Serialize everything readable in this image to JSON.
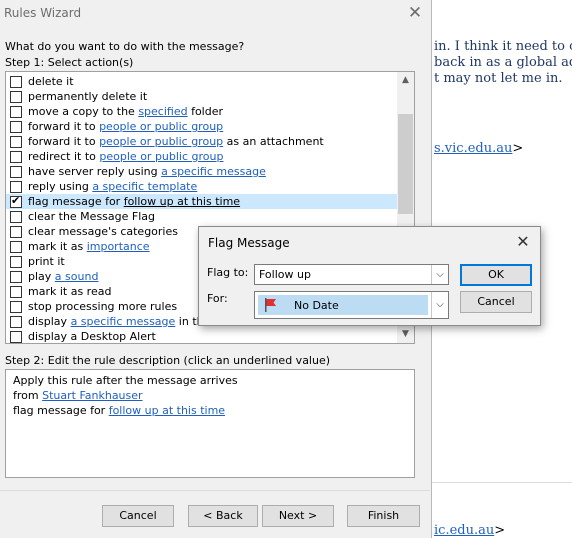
{
  "background_email": {
    "line1": "in. I think it need to ca",
    "line2": "back in as a global adm",
    "line3": "t may not let me in.",
    "email1_domain": "s.vic.edu.au",
    "email1_suffix": ">",
    "email2_domain": "ic.edu.au",
    "email2_suffix": ">"
  },
  "wizard": {
    "title": "Rules Wizard",
    "close_glyph": "✕",
    "question": "What do you want to do with the message?",
    "step1_label": "Step 1: Select action(s)",
    "actions": [
      {
        "checked": false,
        "pre": "delete it",
        "link": "",
        "post": ""
      },
      {
        "checked": false,
        "pre": "permanently delete it",
        "link": "",
        "post": ""
      },
      {
        "checked": false,
        "pre": "move a copy to the ",
        "link": "specified",
        "post": " folder"
      },
      {
        "checked": false,
        "pre": "forward it to ",
        "link": "people or public group",
        "post": ""
      },
      {
        "checked": false,
        "pre": "forward it to ",
        "link": "people or public group",
        "post": " as an attachment"
      },
      {
        "checked": false,
        "pre": "redirect it to ",
        "link": "people or public group",
        "post": ""
      },
      {
        "checked": false,
        "pre": "have server reply using ",
        "link": "a specific message",
        "post": ""
      },
      {
        "checked": false,
        "pre": "reply using ",
        "link": "a specific template",
        "post": ""
      },
      {
        "checked": true,
        "selected": true,
        "pre": "flag message for ",
        "link": "follow up at this time",
        "post": ""
      },
      {
        "checked": false,
        "pre": "clear the Message Flag",
        "link": "",
        "post": ""
      },
      {
        "checked": false,
        "pre": "clear message's categories",
        "link": "",
        "post": ""
      },
      {
        "checked": false,
        "pre": "mark it as ",
        "link": "importance",
        "post": ""
      },
      {
        "checked": false,
        "pre": "print it",
        "link": "",
        "post": ""
      },
      {
        "checked": false,
        "pre": "play ",
        "link": "a sound",
        "post": ""
      },
      {
        "checked": false,
        "pre": "mark it as read",
        "link": "",
        "post": ""
      },
      {
        "checked": false,
        "pre": "stop processing more rules",
        "link": "",
        "post": ""
      },
      {
        "checked": false,
        "pre": "display ",
        "link": "a specific message",
        "post": " in the N"
      },
      {
        "checked": false,
        "pre": "display a Desktop Alert",
        "link": "",
        "post": ""
      }
    ],
    "step2_label": "Step 2: Edit the rule description (click an underlined value)",
    "description": {
      "line1": "Apply this rule after the message arrives",
      "line2_pre": "from ",
      "line2_link": "Stuart Fankhauser",
      "line3_pre": "flag message for ",
      "line3_link": "follow up at this time"
    },
    "buttons": {
      "cancel": "Cancel",
      "back": "< Back",
      "next": "Next >",
      "finish": "Finish"
    },
    "scroll_up_glyph": "▲",
    "scroll_down_glyph": "▼"
  },
  "flag_dialog": {
    "title": "Flag Message",
    "close_glyph": "✕",
    "flag_to_label": "Flag to:",
    "flag_to_value": "Follow up",
    "for_label": "For:",
    "for_value": "No Date",
    "ok_label": "OK",
    "cancel_label": "Cancel",
    "dropdown_glyph": "⌵",
    "flag_color": "#e03030"
  }
}
